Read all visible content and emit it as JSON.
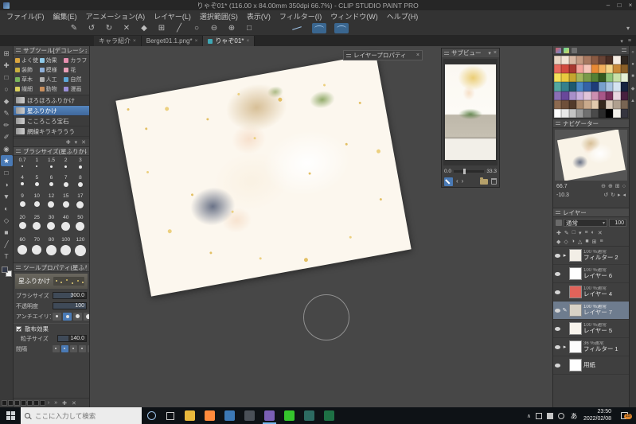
{
  "window": {
    "title": "りゃぞ01* (116.00 x 84.00mm 350dpi 66.7%) - CLIP STUDIO PAINT PRO",
    "minimize": "–",
    "maximize": "□",
    "close": "×"
  },
  "menu": {
    "items": [
      "ファイル(F)",
      "編集(E)",
      "アニメーション(A)",
      "レイヤー(L)",
      "選択範囲(S)",
      "表示(V)",
      "フィルター(I)",
      "ウィンドウ(W)",
      "ヘルプ(H)"
    ]
  },
  "toolbar": {
    "icons": [
      {
        "name": "tool-switch",
        "glyph": "✎"
      },
      {
        "name": "undo",
        "glyph": "↺"
      },
      {
        "name": "redo",
        "glyph": "↻"
      },
      {
        "name": "clear",
        "glyph": "✕"
      },
      {
        "name": "fill",
        "glyph": "◆"
      },
      {
        "name": "grid-view",
        "glyph": "⊞"
      },
      {
        "name": "snap-ruler",
        "glyph": "╱"
      },
      {
        "name": "snap-special-ruler",
        "glyph": "○"
      },
      {
        "name": "zoom-out",
        "glyph": "⊖"
      },
      {
        "name": "zoom-in",
        "glyph": "⊕"
      },
      {
        "name": "reset-display",
        "glyph": "□"
      }
    ],
    "caret": "▾"
  },
  "tabs": {
    "items": [
      {
        "label": "キャラ紹介",
        "close": "×"
      },
      {
        "label": "Berget01.1.png*",
        "close": "×"
      },
      {
        "label": "りゃぞ01*",
        "close": "×",
        "active": true
      }
    ],
    "list_caret": "▾",
    "menu_icon": "≡"
  },
  "toolstrip": {
    "icons": [
      {
        "name": "operation-tool",
        "glyph": "⊞"
      },
      {
        "name": "move-layer-tool",
        "glyph": "✚"
      },
      {
        "name": "selection-tool",
        "glyph": "□"
      },
      {
        "name": "auto-select-tool",
        "glyph": "○"
      },
      {
        "name": "eyedropper-tool",
        "glyph": "◆"
      },
      {
        "name": "pen-tool",
        "glyph": "✎"
      },
      {
        "name": "pencil-tool",
        "glyph": "✏"
      },
      {
        "name": "brush-tool",
        "glyph": "✐"
      },
      {
        "name": "airbrush-tool",
        "glyph": "◉"
      },
      {
        "name": "decoration-tool",
        "glyph": "★",
        "selected": true
      },
      {
        "name": "eraser-tool",
        "glyph": "□"
      },
      {
        "name": "blend-tool",
        "glyph": "◑"
      },
      {
        "name": "fill-tool",
        "glyph": "▼"
      },
      {
        "name": "gradient-tool",
        "glyph": "◐"
      },
      {
        "name": "figure-tool",
        "glyph": "◇"
      },
      {
        "name": "frame-border-tool",
        "glyph": "■"
      },
      {
        "name": "ruler-tool",
        "glyph": "╱"
      },
      {
        "name": "text-tool",
        "glyph": "T"
      }
    ]
  },
  "subtool": {
    "title": "サブツール[デコレーション]",
    "categories": [
      {
        "label": "よく使う",
        "color": "#d9a53f"
      },
      {
        "label": "効果",
        "color": "#8fc9e8"
      },
      {
        "label": "カラフ",
        "color": "#e88fb0"
      },
      {
        "label": "装飾",
        "color": "#c9b03f"
      },
      {
        "label": "模様",
        "color": "#8fb0d9"
      },
      {
        "label": "花",
        "color": "#e8a0b8"
      },
      {
        "label": "草木",
        "color": "#7ab55c"
      },
      {
        "label": "人工",
        "color": "#b0b0b0"
      },
      {
        "label": "自然",
        "color": "#5ca8d9"
      },
      {
        "label": "繊細",
        "color": "#d9d05c"
      },
      {
        "label": "動物",
        "color": "#c98f5c"
      },
      {
        "label": "漫画",
        "color": "#9a8fd9"
      }
    ],
    "brushes": [
      {
        "name": "ほろほろふりかけ"
      },
      {
        "name": "星ふりかけ",
        "selected": true
      },
      {
        "name": "こころころ宝石"
      },
      {
        "name": "網線キラキラうう"
      }
    ],
    "footer_icons": [
      {
        "name": "add-subtool",
        "glyph": "✚"
      },
      {
        "name": "subtool-options",
        "glyph": "▾"
      },
      {
        "name": "delete-subtool",
        "glyph": "✕"
      }
    ]
  },
  "brush_size": {
    "title": "ブラシサイズ(星ふりかけ)",
    "sizes": [
      {
        "v": "0.7",
        "d": "2px"
      },
      {
        "v": "1",
        "d": "2px"
      },
      {
        "v": "1.5",
        "d": "3px"
      },
      {
        "v": "2",
        "d": "3px"
      },
      {
        "v": "3",
        "d": "4px"
      },
      {
        "v": "4",
        "d": "4px"
      },
      {
        "v": "5",
        "d": "5px"
      },
      {
        "v": "6",
        "d": "5px"
      },
      {
        "v": "7",
        "d": "6px"
      },
      {
        "v": "8",
        "d": "6px"
      },
      {
        "v": "9",
        "d": "7px"
      },
      {
        "v": "10",
        "d": "7px"
      },
      {
        "v": "12",
        "d": "8px"
      },
      {
        "v": "15",
        "d": "8px"
      },
      {
        "v": "17",
        "d": "9px"
      },
      {
        "v": "20",
        "d": "9px"
      },
      {
        "v": "25",
        "d": "10px"
      },
      {
        "v": "30",
        "d": "10px"
      },
      {
        "v": "40",
        "d": "11px"
      },
      {
        "v": "50",
        "d": "11px"
      },
      {
        "v": "60",
        "d": "12px"
      },
      {
        "v": "70",
        "d": "12px"
      },
      {
        "v": "80",
        "d": "13px"
      },
      {
        "v": "100",
        "d": "13px"
      },
      {
        "v": "120",
        "d": "14px"
      }
    ]
  },
  "tool_property": {
    "title": "ツールプロパティ(星ふりかけ)",
    "brush_name": "星ふりかけ",
    "sliders": [
      {
        "label": "ブラシサイズ",
        "value": "300.0",
        "fill": "58%"
      },
      {
        "label": "不透明度",
        "value": "100",
        "fill": "100%"
      }
    ],
    "antialias_label": "アンチエイリアス",
    "scatter_label": "散布効果",
    "sliders2": [
      {
        "label": "粒子サイズ",
        "value": "140.0",
        "fill": "38%"
      }
    ],
    "spacing_label": "間隔",
    "footer_icons": [
      {
        "name": "first-setting",
        "glyph": "«"
      },
      {
        "name": "prev-setting",
        "glyph": "‹"
      },
      {
        "name": "register-setting",
        "glyph": "•"
      },
      {
        "name": "next-setting",
        "glyph": "›"
      },
      {
        "name": "last-setting",
        "glyph": "»"
      },
      {
        "name": "add-setting",
        "glyph": "✚"
      },
      {
        "name": "delete-setting",
        "glyph": "✕"
      }
    ]
  },
  "layer_property": {
    "title": "レイヤープロパティ",
    "close": "×"
  },
  "subview": {
    "title": "サブビュー",
    "min": "0.0",
    "zoom": "33.3",
    "caret": "▾",
    "close": "×"
  },
  "navigator": {
    "title": "ナビゲーター",
    "zoom": "66.7",
    "angle": "-10.3",
    "zoom_icons": [
      {
        "name": "zoom-out",
        "glyph": "⊖"
      },
      {
        "name": "zoom-in",
        "glyph": "⊕"
      },
      {
        "name": "fit-to-screen",
        "glyph": "⊞"
      },
      {
        "name": "actual-pixels",
        "glyph": "○"
      }
    ],
    "rotate_icons": [
      {
        "name": "rotate-left",
        "glyph": "↺"
      },
      {
        "name": "rotate-right",
        "glyph": "↻"
      },
      {
        "name": "reset-rotation",
        "glyph": "▸"
      },
      {
        "name": "flip-horizontal",
        "glyph": "◂"
      }
    ]
  },
  "layers": {
    "title": "レイヤー",
    "blend_mode": "通常",
    "blend_caret": "▾",
    "opacity": "100",
    "tools_row1": [
      {
        "name": "new-raster-layer",
        "glyph": "✚"
      },
      {
        "name": "new-vector-layer",
        "glyph": "✎"
      },
      {
        "name": "new-folder",
        "glyph": "□"
      },
      {
        "name": "transfer-to-lower",
        "glyph": "▾"
      },
      {
        "name": "merge-down",
        "glyph": "≡"
      },
      {
        "name": "create-mask",
        "glyph": "◐"
      },
      {
        "name": "delete-layer",
        "glyph": "✕"
      }
    ],
    "tools_row2": [
      {
        "name": "lock-layer",
        "glyph": "◆"
      },
      {
        "name": "lock-transparent-pixels",
        "glyph": "◇"
      },
      {
        "name": "enable-mask",
        "glyph": "◑"
      },
      {
        "name": "set-ruler",
        "glyph": "△"
      },
      {
        "name": "layer-color",
        "glyph": "■"
      },
      {
        "name": "two-pane-view",
        "glyph": "⊞"
      },
      {
        "name": "layer-palette-menu",
        "glyph": "≡"
      }
    ],
    "items": [
      {
        "info": "100 %通常",
        "name": "フィルター 2",
        "thumb": "#f2eee6",
        "chevron": true
      },
      {
        "info": "100 %通常",
        "name": "レイヤー 6",
        "thumb": "#ffffff"
      },
      {
        "info": "100 %通常",
        "name": "レイヤー 4",
        "thumb": "#e0635a"
      },
      {
        "info": "100 %通常",
        "name": "レイヤー 7",
        "thumb": "#d8d2c6",
        "selected": true
      },
      {
        "info": "100 %通常",
        "name": "レイヤー 5",
        "thumb": "#f8f4ec"
      },
      {
        "info": "36 %通常",
        "name": "フィルター 1",
        "thumb": "#fdfdfd",
        "chevron": true
      },
      {
        "info": "",
        "name": "用紙",
        "thumb": "#ffffff"
      }
    ]
  },
  "color_set": {
    "colors": [
      "#e8d5c4",
      "#f2e3d5",
      "#d9b8a3",
      "#c49a82",
      "#a87860",
      "#8a5a42",
      "#684335",
      "#4a2e24",
      "#f5ece2",
      "#2e2620",
      "#e86a5f",
      "#d14a3f",
      "#a83830",
      "#f2a39a",
      "#f5c4b8",
      "#e88a35",
      "#f2b05c",
      "#f5d488",
      "#c98a3a",
      "#8a5f28",
      "#f5e05a",
      "#e8c93f",
      "#c4a52f",
      "#a3b55c",
      "#7a9a4a",
      "#548035",
      "#35591f",
      "#8fc478",
      "#c9e0a8",
      "#e5f0d5",
      "#54a8a0",
      "#35808c",
      "#1f596e",
      "#4a88c4",
      "#3563a8",
      "#1f3c78",
      "#78a0cc",
      "#a8c4e0",
      "#d5e3f0",
      "#16233f",
      "#8a6fb5",
      "#69489a",
      "#a88fc9",
      "#c9b0dd",
      "#e0c4d9",
      "#cc8fb0",
      "#a85788",
      "#7a2f5c",
      "#e8d5e0",
      "#47203f",
      "#8c6a50",
      "#6e4f3a",
      "#523a2a",
      "#a8876a",
      "#c9aa8c",
      "#e0c9ad",
      "#35281c",
      "#d9c9b8",
      "#b0a08f",
      "#786553",
      "#ffffff",
      "#e8e8e8",
      "#c4c4c4",
      "#9a9a9a",
      "#707070",
      "#4a4a4a",
      "#2a2a2a",
      "#000000",
      "#f2f0ea",
      "#35353f"
    ]
  },
  "side_tabs": {
    "icons": [
      {
        "name": "collapse-dock",
        "glyph": "«"
      },
      {
        "name": "color-wheel-tab",
        "glyph": "●"
      },
      {
        "name": "material-tab",
        "glyph": "■"
      },
      {
        "name": "history-tab",
        "glyph": "◆"
      },
      {
        "name": "information-tab",
        "glyph": "▲"
      }
    ]
  },
  "taskbar": {
    "search_placeholder": "ここに入力して検索",
    "apps": [
      {
        "name": "file-explorer",
        "color": "#e8b83c"
      },
      {
        "name": "firefox",
        "color": "#ff8a3c",
        "round": true
      },
      {
        "name": "edge-browser",
        "color": "#3c78b5",
        "round": true
      },
      {
        "name": "media-app",
        "color": "#4a5058",
        "round": true
      },
      {
        "name": "clip-studio-paint",
        "color": "#7a5fb5",
        "running": true
      },
      {
        "name": "line",
        "color": "#35c52d"
      },
      {
        "name": "paint-app",
        "color": "#2d6b62",
        "round": true
      },
      {
        "name": "excel",
        "color": "#1e7145"
      }
    ],
    "tray_chevron": "∧",
    "ime": "あ",
    "time": "23:50",
    "date": "2022/02/08",
    "badge": "15"
  }
}
